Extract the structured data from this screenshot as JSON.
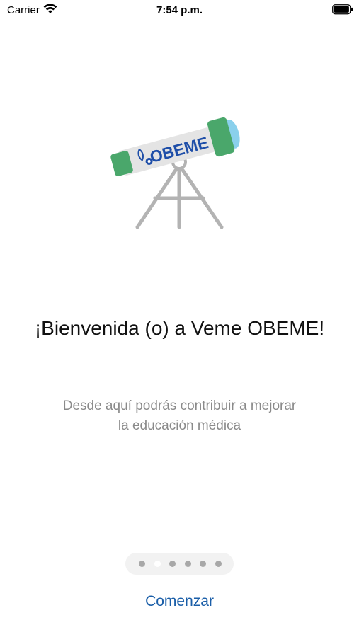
{
  "status_bar": {
    "carrier": "Carrier",
    "time": "7:54 p.m.",
    "icons": [
      "wifi-icon",
      "battery-icon"
    ]
  },
  "illustration": {
    "logo_text": "OBEME",
    "icon": "telescope-icon",
    "colors": {
      "tube": "#e4e4e4",
      "bands": "#4aa76b",
      "lens": "#8ad0ec",
      "logo": "#1e4ea8",
      "tripod": "#b3b3b3"
    }
  },
  "welcome": {
    "title": "¡Bienvenida (o) a Veme OBEME!",
    "subtitle_line1": "Desde aquí podrás contribuir a mejorar",
    "subtitle_line2": "la educación médica"
  },
  "pager": {
    "total_pages": 6,
    "current_page": 2
  },
  "actions": {
    "start_label": "Comenzar"
  },
  "colors": {
    "accent": "#1a5ea8",
    "subtitle": "#8a8a8a",
    "title": "#111111"
  }
}
